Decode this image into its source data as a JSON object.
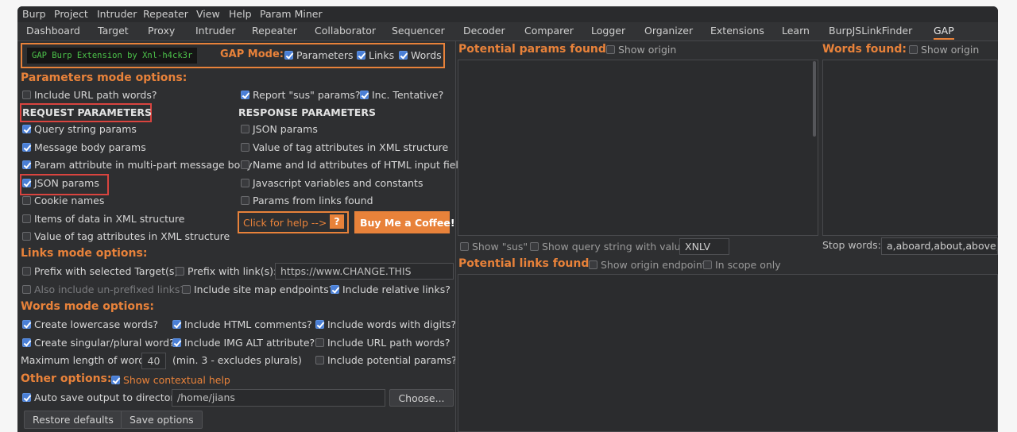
{
  "menubar": [
    "Burp",
    "Project",
    "Intruder",
    "Repeater",
    "View",
    "Help",
    "Param Miner"
  ],
  "tabs": [
    "Dashboard",
    "Target",
    "Proxy",
    "Intruder",
    "Repeater",
    "Collaborator",
    "Sequencer",
    "Decoder",
    "Comparer",
    "Logger",
    "Organizer",
    "Extensions",
    "Learn",
    "BurpJSLinkFinder",
    "GAP"
  ],
  "header": {
    "logo": "GAP Burp Extension by Xnl-h4ck3r",
    "mode_label": "GAP Mode:",
    "mode_parameters": "Parameters",
    "mode_links": "Links",
    "mode_words": "Words"
  },
  "params": {
    "title": "Parameters mode options:",
    "include_url_path": "Include URL path words?",
    "report_sus": "Report \"sus\" params?",
    "inc_tentative": "Inc. Tentative?",
    "request_header": "REQUEST PARAMETERS",
    "response_header": "RESPONSE PARAMETERS",
    "query_string": "Query string params",
    "message_body": "Message body params",
    "param_attribute": "Param attribute in multi-part message body",
    "json_params": "JSON params",
    "cookie_names": "Cookie names",
    "xml_items": "Items of data in XML structure",
    "xml_tag_values": "Value of tag attributes in XML structure",
    "resp_json": "JSON params",
    "resp_xml": "Value of tag attributes in XML structure",
    "resp_html": "Name and Id attributes of HTML input fields",
    "resp_js": "Javascript variables and constants",
    "resp_links": "Params from links found",
    "help": "Click for help -->",
    "help_q": "?",
    "coffee": "Buy Me a Coffee!"
  },
  "links": {
    "title": "Links mode options:",
    "prefix_target": "Prefix with selected Target(s)",
    "prefix_link": "Prefix with link(s):",
    "prefix_placeholder": "https://www.CHANGE.THIS",
    "unprefixed": "Also include un-prefixed links?",
    "site_map": "Include site map endpoints?",
    "relative": "Include relative links?"
  },
  "words": {
    "title": "Words mode options:",
    "lowercase": "Create lowercase words?",
    "html_comments": "Include HTML comments?",
    "digits": "Include words with digits?",
    "singular_plural": "Create singular/plural word?",
    "img_alt": "Include IMG ALT attribute?",
    "url_path": "Include URL path words?",
    "max_len_label": "Maximum length of words",
    "max_len": "40",
    "max_len_note": "(min. 3 - excludes plurals)",
    "potential_params": "Include potential params?"
  },
  "other": {
    "title": "Other options:",
    "contextual_help": "Show contextual help",
    "autosave": "Auto save output to directory",
    "directory": "/home/jians",
    "choose": "Choose...",
    "restore": "Restore defaults",
    "save": "Save options"
  },
  "right": {
    "params_found": "Potential params found:",
    "show_origin": "Show origin",
    "words_found": "Words found:",
    "words_show_origin": "Show origin",
    "show_sus": "Show \"sus\"",
    "show_query": "Show query string with value",
    "query_value": "XNLV",
    "stop_words_label": "Stop words:",
    "stop_words": "a,aboard,about,above,ac",
    "links_found": "Potential links found:",
    "show_origin_endpoint": "Show origin endpoint",
    "in_scope": "In scope only"
  }
}
